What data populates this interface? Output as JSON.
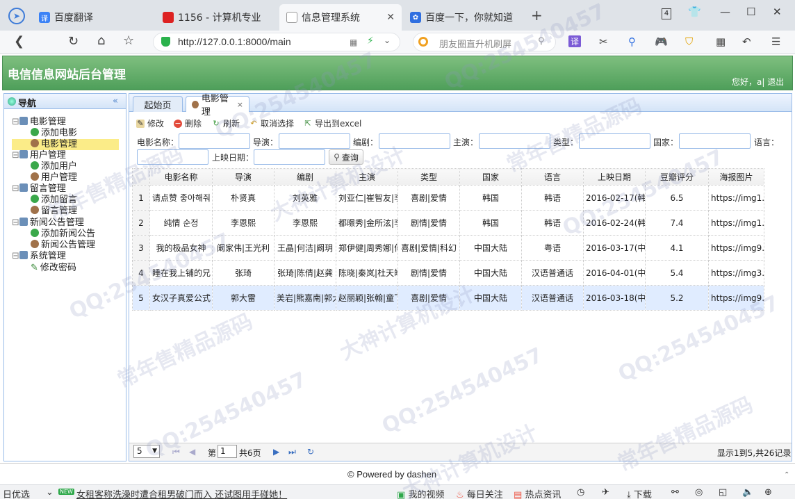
{
  "browser": {
    "tabs": [
      {
        "label": "百度翻译"
      },
      {
        "label": "1156 - 计算机专业"
      },
      {
        "label": "信息管理系统"
      },
      {
        "label": "百度一下，你就知道"
      }
    ],
    "new_tab": "+",
    "tab_count": "4",
    "url": "http://127.0.0.1:8000/main",
    "search_placeholder": "朋友圈直升机刷屏",
    "translate_btn": "译"
  },
  "app": {
    "title": "电信信息网站后台管理",
    "greeting": "您好，a| 退出"
  },
  "nav": {
    "title": "导航",
    "groups": [
      {
        "label": "电影管理",
        "items": [
          "添加电影",
          "电影管理"
        ]
      },
      {
        "label": "用户管理",
        "items": [
          "添加用户",
          "用户管理"
        ]
      },
      {
        "label": "留言管理",
        "items": [
          "添加留言",
          "留言管理"
        ]
      },
      {
        "label": "新闻公告管理",
        "items": [
          "添加新闻公告",
          "新闻公告管理"
        ]
      },
      {
        "label": "系统管理",
        "items": [
          "修改密码"
        ]
      }
    ]
  },
  "page_tabs": [
    {
      "label": "起始页"
    },
    {
      "label": "电影管理",
      "close": "×"
    }
  ],
  "toolbar": {
    "edit": "修改",
    "delete": "删除",
    "refresh": "刷新",
    "cancel": "取消选择",
    "export": "导出到excel"
  },
  "filters": {
    "name": "电影名称：",
    "director": "导演：",
    "writer": "编剧：",
    "actor": "主演：",
    "type": "类型：",
    "country": "国家：",
    "language": "语言：",
    "date": "上映日期：",
    "query": "查询"
  },
  "grid": {
    "columns": [
      "电影名称",
      "导演",
      "编剧",
      "主演",
      "类型",
      "国家",
      "语言",
      "上映日期",
      "豆瓣评分",
      "海报图片"
    ],
    "rows": [
      {
        "n": "1",
        "cells": [
          "请点赞 좋아해줘",
          "朴贤真",
          "刘英雅",
          "刘亚仁|崔智友|李",
          "喜剧|爱情",
          "韩国",
          "韩语",
          "2016-02-17(韩",
          "6.5",
          "https://img1.d"
        ]
      },
      {
        "n": "2",
        "cells": [
          "纯情 순정",
          "李恩熙",
          "李恩熙",
          "都暻秀|金所泫|李",
          "剧情|爱情",
          "韩国",
          "韩语",
          "2016-02-24(韩",
          "7.4",
          "https://img1.d"
        ]
      },
      {
        "n": "3",
        "cells": [
          "我的极品女神",
          "阚家伟|王光利",
          "王晶|何洁|阚玥",
          "郑伊健|周秀娜|何",
          "喜剧|爱情|科幻",
          "中国大陆",
          "粤语",
          "2016-03-17(中",
          "4.1",
          "https://img9.d"
        ]
      },
      {
        "n": "4",
        "cells": [
          "睡在我上铺的兄",
          "张琦",
          "张琦|陈倩|赵龚",
          "陈晓|秦岚|杜天皓",
          "剧情|爱情",
          "中国大陆",
          "汉语普通话",
          "2016-04-01(中",
          "5.4",
          "https://img3.d"
        ]
      },
      {
        "n": "5",
        "cells": [
          "女汉子真爱公式",
          "郭大雷",
          "美岩|熊嘉南|郭大",
          "赵丽颖|张翰|童飞",
          "喜剧|爱情",
          "中国大陆",
          "汉语普通话",
          "2016-03-18(中",
          "5.2",
          "https://img9.d"
        ]
      }
    ]
  },
  "pager": {
    "page_size": "5",
    "page_label": "第",
    "page_value": "1",
    "total_pages": "共6页",
    "summary": "显示1到5,共26记录"
  },
  "footer": {
    "powered": "© Powered by dashen"
  },
  "statusbar": {
    "left": "日优选",
    "news_badge": "NEW",
    "news": "女租客称洗澡时遭合租男破门而入 还试图用手碰她！",
    "video": "我的视频",
    "follow": "每日关注",
    "hot": "热点资讯",
    "download": "下载"
  },
  "watermark": {
    "qq": "QQ:254540457",
    "a": "常年售精品源码",
    "b": "大神计算机设计"
  },
  "colors": {
    "header_green": "#5aab66",
    "selected_nav": "#fbec88",
    "border_blue": "#99bbe8"
  }
}
